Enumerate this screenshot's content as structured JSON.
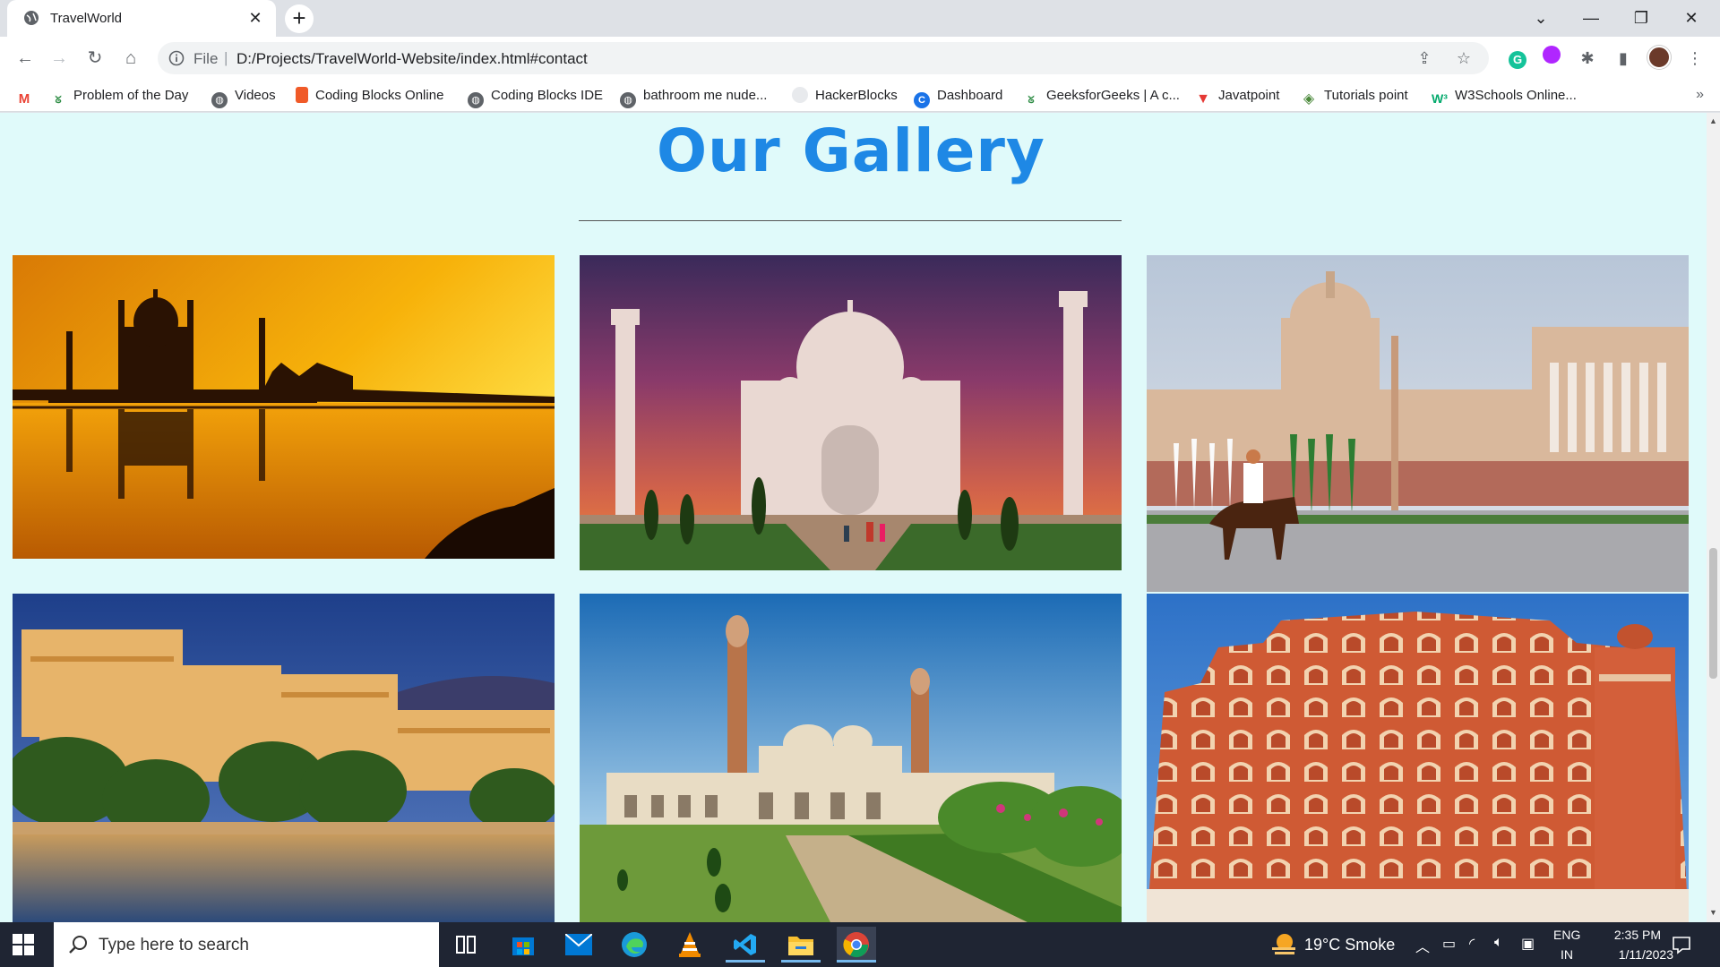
{
  "browser": {
    "tab_title": "TravelWorld",
    "url_scheme": "File",
    "url": "D:/Projects/TravelWorld-Website/index.html#contact"
  },
  "bookmarks": [
    {
      "label": "",
      "icon": "gmail-icon"
    },
    {
      "label": "Problem of the Day",
      "icon": "gfg-icon"
    },
    {
      "label": "Videos",
      "icon": "globe-icon"
    },
    {
      "label": "Coding Blocks Online",
      "icon": "codingblocks-icon"
    },
    {
      "label": "Coding Blocks IDE",
      "icon": "globe-icon"
    },
    {
      "label": "bathroom me nude...",
      "icon": "globe-icon"
    },
    {
      "label": "HackerBlocks",
      "icon": "hackerblocks-icon"
    },
    {
      "label": "Dashboard",
      "icon": "dashboard-icon"
    },
    {
      "label": "GeeksforGeeks | A c...",
      "icon": "gfg-icon"
    },
    {
      "label": "Javatpoint",
      "icon": "javatpoint-icon"
    },
    {
      "label": "Tutorials point",
      "icon": "tutorialspoint-icon"
    },
    {
      "label": "W3Schools Online...",
      "icon": "w3schools-icon"
    }
  ],
  "page": {
    "heading": "Our Gallery",
    "gallery": [
      {
        "subject": "taj-mahal-sunset"
      },
      {
        "subject": "taj-mahal-dusk"
      },
      {
        "subject": "rashtrapati-bhavan"
      },
      {
        "subject": "udaipur-city-palace"
      },
      {
        "subject": "bara-imambara-mosque"
      },
      {
        "subject": "hawa-mahal"
      }
    ]
  },
  "taskbar": {
    "search_placeholder": "Type here to search",
    "weather": "19°C  Smoke",
    "lang_top": "ENG",
    "lang_bottom": "IN",
    "time": "2:35 PM",
    "date": "1/11/2023"
  },
  "colors": {
    "page_background": "#e0fafa",
    "heading": "#1e88e5"
  }
}
